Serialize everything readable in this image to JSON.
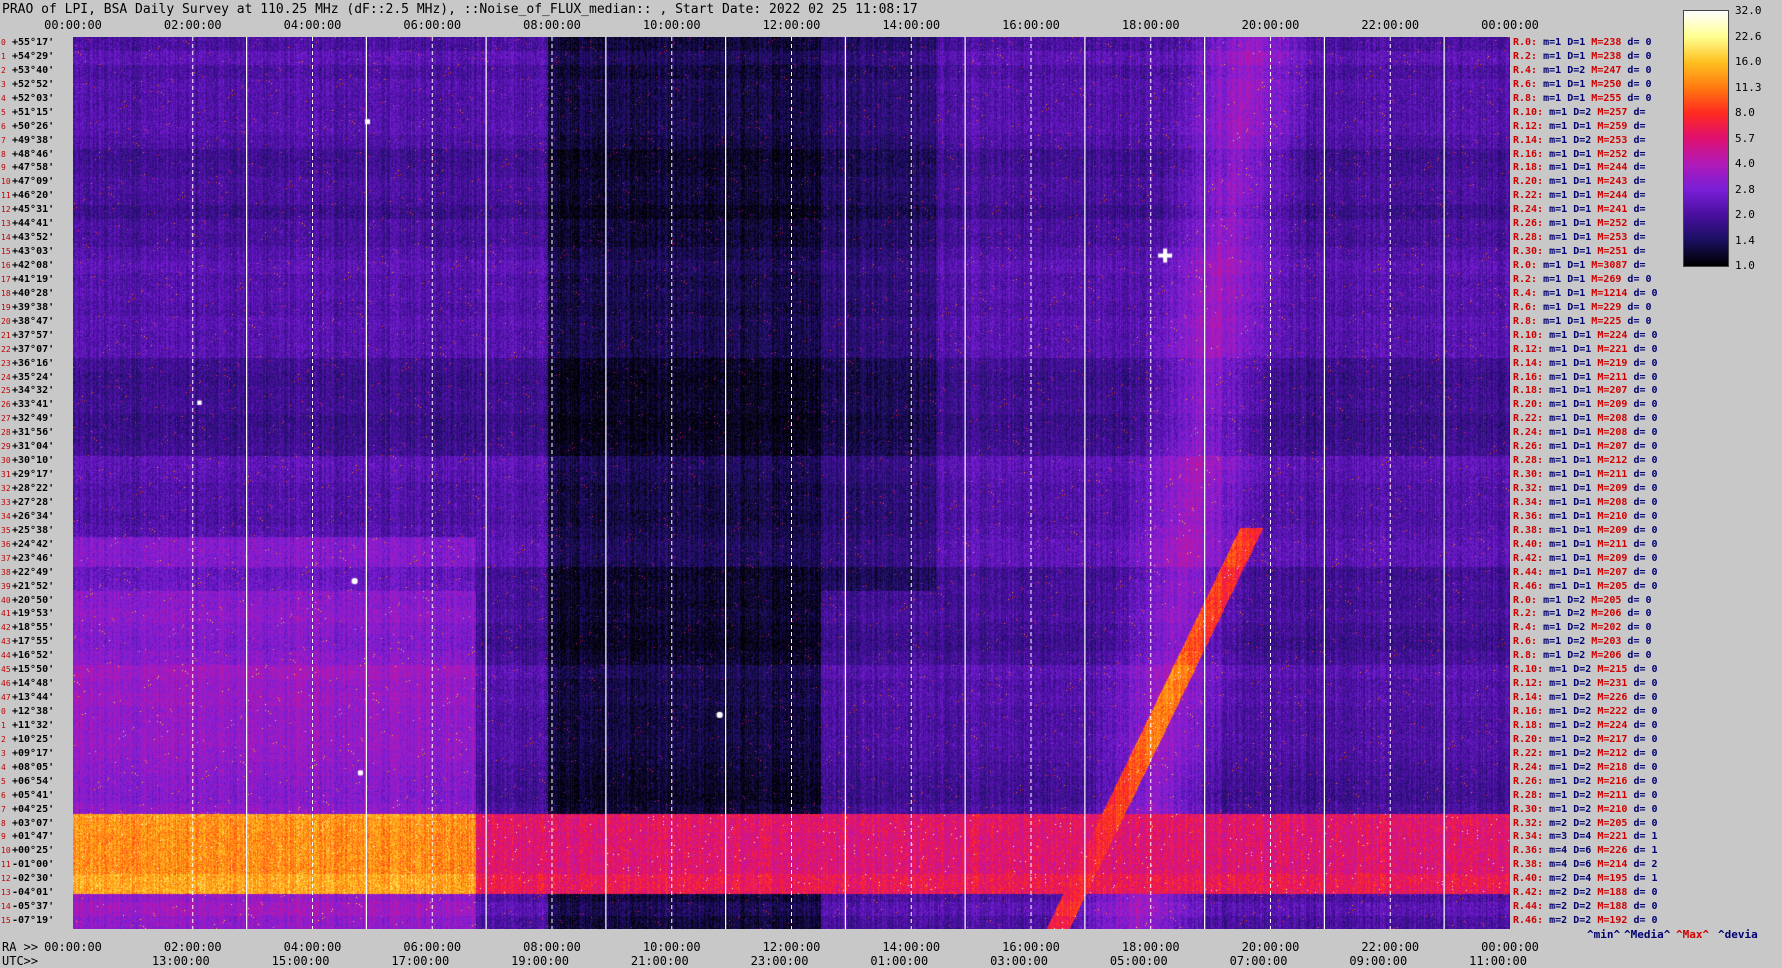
{
  "title": "PRAO of LPI, BSA Daily Survey at 110.25 MHz (dF::2.5 MHz), ::Noise_of_FLUX_median:: , Start Date: 2022 02 25 11:08:17",
  "chart_data": {
    "type": "heatmap",
    "title": "PRAO of LPI, BSA Daily Survey at 110.25 MHz (dF::2.5 MHz), ::Noise_of_FLUX_median:: , Start Date: 2022 02 25 11:08:17",
    "x_top_ticks": [
      "00:00:00",
      "02:00:00",
      "04:00:00",
      "06:00:00",
      "08:00:00",
      "10:00:00",
      "12:00:00",
      "14:00:00",
      "16:00:00",
      "18:00:00",
      "20:00:00",
      "22:00:00",
      "00:00:00"
    ],
    "ra_ticks": [
      "00:00:00",
      "02:00:00",
      "04:00:00",
      "06:00:00",
      "08:00:00",
      "10:00:00",
      "12:00:00",
      "14:00:00",
      "16:00:00",
      "18:00:00",
      "20:00:00",
      "22:00:00",
      "00:00:00"
    ],
    "utc_ticks": [
      "13:00:00",
      "15:00:00",
      "17:00:00",
      "19:00:00",
      "21:00:00",
      "23:00:00",
      "01:00:00",
      "03:00:00",
      "05:00:00",
      "07:00:00",
      "09:00:00",
      "11:00:00"
    ],
    "ra_label": "RA >>",
    "utc_label": "UTC>>",
    "y_labels": [
      "+55°17'",
      "+54°29'",
      "+53°40'",
      "+52°52'",
      "+52°03'",
      "+51°15'",
      "+50°26'",
      "+49°38'",
      "+48°46'",
      "+47°58'",
      "+47°09'",
      "+46°20'",
      "+45°31'",
      "+44°41'",
      "+43°52'",
      "+43°03'",
      "+42°08'",
      "+41°19'",
      "+40°28'",
      "+39°38'",
      "+38°47'",
      "+37°57'",
      "+37°07'",
      "+36°16'",
      "+35°24'",
      "+34°32'",
      "+33°41'",
      "+32°49'",
      "+31°56'",
      "+31°04'",
      "+30°10'",
      "+29°17'",
      "+28°22'",
      "+27°28'",
      "+26°34'",
      "+25°38'",
      "+24°42'",
      "+23°46'",
      "+22°49'",
      "+21°52'",
      "+20°50'",
      "+19°53'",
      "+18°55'",
      "+17°55'",
      "+16°52'",
      "+15°50'",
      "+14°48'",
      "+13°44'",
      "+12°38'",
      "+11°32'",
      "+10°25'",
      "+09°17'",
      "+08°05'",
      "+06°54'",
      "+05°41'",
      "+04°25'",
      "+03°07'",
      "+01°47'",
      "+00°25'",
      "-01°00'",
      "-02°30'",
      "-04°01'",
      "-05°37'",
      "-07°19'"
    ],
    "colorbar": {
      "ticks": [
        "32.0",
        "22.6",
        "16.0",
        "11.3",
        "8.0",
        "5.7",
        "4.0",
        "2.8",
        "2.0",
        "1.4",
        "1.0"
      ],
      "scale": "log"
    },
    "rows": [
      {
        "r": "R.0:",
        "m": "m=1",
        "d": "D=1",
        "h": "M=238",
        "v": "d= 0"
      },
      {
        "r": "R.2:",
        "m": "m=1",
        "d": "D=1",
        "h": "M=238",
        "v": "d= 0"
      },
      {
        "r": "R.4:",
        "m": "m=1",
        "d": "D=2",
        "h": "M=247",
        "v": "d= 0"
      },
      {
        "r": "R.6:",
        "m": "m=1",
        "d": "D=1",
        "h": "M=250",
        "v": "d= 0"
      },
      {
        "r": "R.8:",
        "m": "m=1",
        "d": "D=1",
        "h": "M=255",
        "v": "d= 0"
      },
      {
        "r": "R.10:",
        "m": "m=1",
        "d": "D=2",
        "h": "M=257",
        "v": "d="
      },
      {
        "r": "R.12:",
        "m": "m=1",
        "d": "D=1",
        "h": "M=259",
        "v": "d="
      },
      {
        "r": "R.14:",
        "m": "m=1",
        "d": "D=2",
        "h": "M=253",
        "v": "d="
      },
      {
        "r": "R.16:",
        "m": "m=1",
        "d": "D=1",
        "h": "M=252",
        "v": "d="
      },
      {
        "r": "R.18:",
        "m": "m=1",
        "d": "D=1",
        "h": "M=244",
        "v": "d="
      },
      {
        "r": "R.20:",
        "m": "m=1",
        "d": "D=1",
        "h": "M=243",
        "v": "d="
      },
      {
        "r": "R.22:",
        "m": "m=1",
        "d": "D=1",
        "h": "M=244",
        "v": "d="
      },
      {
        "r": "R.24:",
        "m": "m=1",
        "d": "D=1",
        "h": "M=241",
        "v": "d="
      },
      {
        "r": "R.26:",
        "m": "m=1",
        "d": "D=1",
        "h": "M=252",
        "v": "d="
      },
      {
        "r": "R.28:",
        "m": "m=1",
        "d": "D=1",
        "h": "M=253",
        "v": "d="
      },
      {
        "r": "R.30:",
        "m": "m=1",
        "d": "D=1",
        "h": "M=251",
        "v": "d="
      },
      {
        "r": "R.0:",
        "m": "m=1",
        "d": "D=1",
        "h": "M=3087",
        "v": "d="
      },
      {
        "r": "R.2:",
        "m": "m=1",
        "d": "D=1",
        "h": "M=269",
        "v": "d= 0"
      },
      {
        "r": "R.4:",
        "m": "m=1",
        "d": "D=1",
        "h": "M=1214",
        "v": "d= 0"
      },
      {
        "r": "R.6:",
        "m": "m=1",
        "d": "D=1",
        "h": "M=229",
        "v": "d= 0"
      },
      {
        "r": "R.8:",
        "m": "m=1",
        "d": "D=1",
        "h": "M=225",
        "v": "d= 0"
      },
      {
        "r": "R.10:",
        "m": "m=1",
        "d": "D=1",
        "h": "M=224",
        "v": "d= 0"
      },
      {
        "r": "R.12:",
        "m": "m=1",
        "d": "D=1",
        "h": "M=221",
        "v": "d= 0"
      },
      {
        "r": "R.14:",
        "m": "m=1",
        "d": "D=1",
        "h": "M=219",
        "v": "d= 0"
      },
      {
        "r": "R.16:",
        "m": "m=1",
        "d": "D=1",
        "h": "M=211",
        "v": "d= 0"
      },
      {
        "r": "R.18:",
        "m": "m=1",
        "d": "D=1",
        "h": "M=207",
        "v": "d= 0"
      },
      {
        "r": "R.20:",
        "m": "m=1",
        "d": "D=1",
        "h": "M=209",
        "v": "d= 0"
      },
      {
        "r": "R.22:",
        "m": "m=1",
        "d": "D=1",
        "h": "M=208",
        "v": "d= 0"
      },
      {
        "r": "R.24:",
        "m": "m=1",
        "d": "D=1",
        "h": "M=208",
        "v": "d= 0"
      },
      {
        "r": "R.26:",
        "m": "m=1",
        "d": "D=1",
        "h": "M=207",
        "v": "d= 0"
      },
      {
        "r": "R.28:",
        "m": "m=1",
        "d": "D=1",
        "h": "M=212",
        "v": "d= 0"
      },
      {
        "r": "R.30:",
        "m": "m=1",
        "d": "D=1",
        "h": "M=211",
        "v": "d= 0"
      },
      {
        "r": "R.32:",
        "m": "m=1",
        "d": "D=1",
        "h": "M=209",
        "v": "d= 0"
      },
      {
        "r": "R.34:",
        "m": "m=1",
        "d": "D=1",
        "h": "M=208",
        "v": "d= 0"
      },
      {
        "r": "R.36:",
        "m": "m=1",
        "d": "D=1",
        "h": "M=210",
        "v": "d= 0"
      },
      {
        "r": "R.38:",
        "m": "m=1",
        "d": "D=1",
        "h": "M=209",
        "v": "d= 0"
      },
      {
        "r": "R.40:",
        "m": "m=1",
        "d": "D=1",
        "h": "M=211",
        "v": "d= 0"
      },
      {
        "r": "R.42:",
        "m": "m=1",
        "d": "D=1",
        "h": "M=209",
        "v": "d= 0"
      },
      {
        "r": "R.44:",
        "m": "m=1",
        "d": "D=1",
        "h": "M=207",
        "v": "d= 0"
      },
      {
        "r": "R.46:",
        "m": "m=1",
        "d": "D=1",
        "h": "M=205",
        "v": "d= 0"
      },
      {
        "r": "R.0:",
        "m": "m=1",
        "d": "D=2",
        "h": "M=205",
        "v": "d= 0"
      },
      {
        "r": "R.2:",
        "m": "m=1",
        "d": "D=2",
        "h": "M=206",
        "v": "d= 0"
      },
      {
        "r": "R.4:",
        "m": "m=1",
        "d": "D=2",
        "h": "M=202",
        "v": "d= 0"
      },
      {
        "r": "R.6:",
        "m": "m=1",
        "d": "D=2",
        "h": "M=203",
        "v": "d= 0"
      },
      {
        "r": "R.8:",
        "m": "m=1",
        "d": "D=2",
        "h": "M=206",
        "v": "d= 0"
      },
      {
        "r": "R.10:",
        "m": "m=1",
        "d": "D=2",
        "h": "M=215",
        "v": "d= 0"
      },
      {
        "r": "R.12:",
        "m": "m=1",
        "d": "D=2",
        "h": "M=231",
        "v": "d= 0"
      },
      {
        "r": "R.14:",
        "m": "m=1",
        "d": "D=2",
        "h": "M=226",
        "v": "d= 0"
      },
      {
        "r": "R.16:",
        "m": "m=1",
        "d": "D=2",
        "h": "M=222",
        "v": "d= 0"
      },
      {
        "r": "R.18:",
        "m": "m=1",
        "d": "D=2",
        "h": "M=224",
        "v": "d= 0"
      },
      {
        "r": "R.20:",
        "m": "m=1",
        "d": "D=2",
        "h": "M=217",
        "v": "d= 0"
      },
      {
        "r": "R.22:",
        "m": "m=1",
        "d": "D=2",
        "h": "M=212",
        "v": "d= 0"
      },
      {
        "r": "R.24:",
        "m": "m=1",
        "d": "D=2",
        "h": "M=218",
        "v": "d= 0"
      },
      {
        "r": "R.26:",
        "m": "m=1",
        "d": "D=2",
        "h": "M=216",
        "v": "d= 0"
      },
      {
        "r": "R.28:",
        "m": "m=1",
        "d": "D=2",
        "h": "M=211",
        "v": "d= 0"
      },
      {
        "r": "R.30:",
        "m": "m=1",
        "d": "D=2",
        "h": "M=210",
        "v": "d= 0"
      },
      {
        "r": "R.32:",
        "m": "m=2",
        "d": "D=2",
        "h": "M=205",
        "v": "d= 0"
      },
      {
        "r": "R.34:",
        "m": "m=3",
        "d": "D=4",
        "h": "M=221",
        "v": "d= 1"
      },
      {
        "r": "R.36:",
        "m": "m=4",
        "d": "D=6",
        "h": "M=226",
        "v": "d= 1"
      },
      {
        "r": "R.38:",
        "m": "m=4",
        "d": "D=6",
        "h": "M=214",
        "v": "d= 2"
      },
      {
        "r": "R.40:",
        "m": "m=2",
        "d": "D=4",
        "h": "M=195",
        "v": "d= 1"
      },
      {
        "r": "R.42:",
        "m": "m=2",
        "d": "D=2",
        "h": "M=188",
        "v": "d= 0"
      },
      {
        "r": "R.44:",
        "m": "m=2",
        "d": "D=2",
        "h": "M=188",
        "v": "d= 0"
      },
      {
        "r": "R.46:",
        "m": "m=2",
        "d": "D=2",
        "h": "M=192",
        "v": "d= 0"
      }
    ],
    "legend": {
      "min": "^min^",
      "media": "^Media^",
      "max": "^Max^",
      "devia": "^devia"
    },
    "palette": [
      "#000000",
      "#1a0f60",
      "#4a0fa0",
      "#7a1fd8",
      "#b01ab8",
      "#e01070",
      "#ff2a20",
      "#ff7a10",
      "#ffc020",
      "#ffff90",
      "#ffffff"
    ]
  }
}
